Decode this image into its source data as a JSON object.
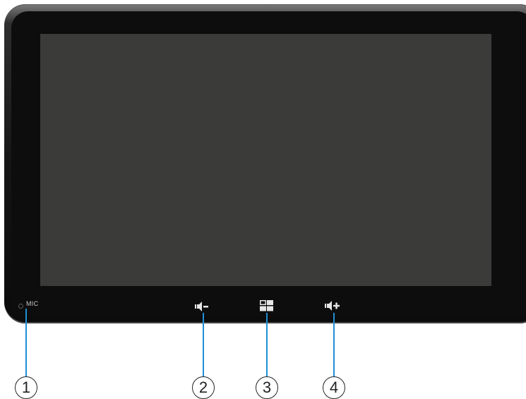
{
  "device": {
    "mic_label": "MIC",
    "screen_color": "#3b3c3a",
    "buttons": [
      {
        "icon": "volume-down-icon",
        "callout": "2"
      },
      {
        "icon": "home-grid-icon",
        "callout": "3"
      },
      {
        "icon": "volume-up-icon",
        "callout": "4"
      }
    ]
  },
  "callouts": {
    "mic": "1",
    "volume_down": "2",
    "home": "3",
    "volume_up": "4"
  },
  "colors": {
    "leader_line": "#1e90d6",
    "bezel": "#0d0d0d",
    "callout_stroke": "#222222"
  }
}
